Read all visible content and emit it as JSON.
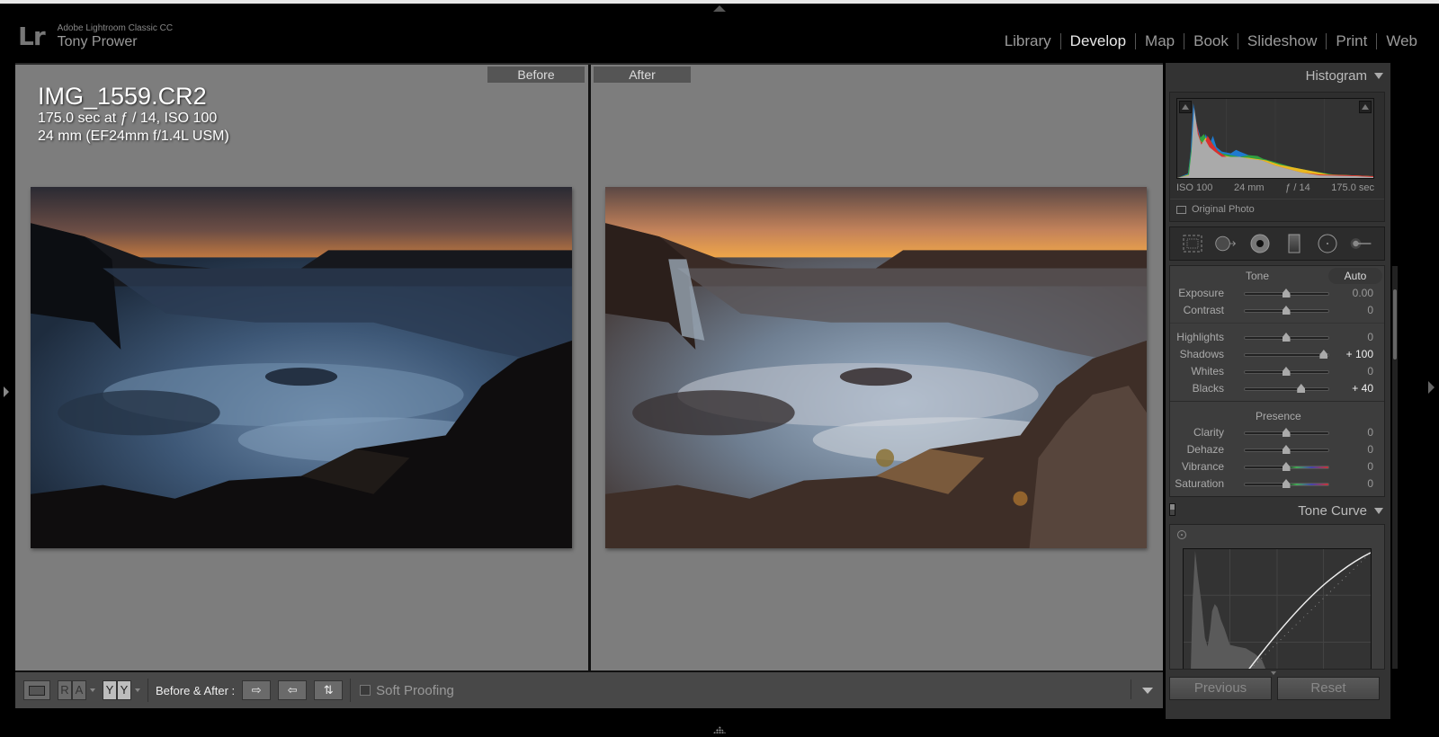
{
  "app": {
    "name": "Adobe Lightroom Classic CC",
    "user": "Tony Prower",
    "logo": "Lr"
  },
  "modules": [
    {
      "label": "Library",
      "active": false
    },
    {
      "label": "Develop",
      "active": true
    },
    {
      "label": "Map",
      "active": false
    },
    {
      "label": "Book",
      "active": false
    },
    {
      "label": "Slideshow",
      "active": false
    },
    {
      "label": "Print",
      "active": false
    },
    {
      "label": "Web",
      "active": false
    }
  ],
  "view": {
    "before_label": "Before",
    "after_label": "After",
    "info": {
      "filename": "IMG_1559.CR2",
      "exposure_line": "175.0 sec at ƒ / 14, ISO 100",
      "lens_line": "24 mm (EF24mm f/1.4L USM)"
    }
  },
  "toolbar": {
    "loupe_icon": "loupe-view-icon",
    "ra_left": "R",
    "ra_right": "A",
    "yy_left": "Y",
    "yy_right": "Y",
    "before_after_label": "Before & After :",
    "copy_before_to_after": "⇨",
    "copy_after_to_before": "⇦",
    "swap": "⇅",
    "soft_proofing_label": "Soft Proofing",
    "soft_proofing_checked": false
  },
  "histogram": {
    "title": "Histogram",
    "iso": "ISO 100",
    "focal": "24 mm",
    "aperture": "ƒ / 14",
    "shutter": "175.0 sec",
    "original_photo_label": "Original Photo"
  },
  "basic": {
    "tone_title": "Tone",
    "auto_label": "Auto",
    "presence_title": "Presence",
    "tone_sliders": [
      {
        "label": "Exposure",
        "value": "0.00",
        "position": 0.5,
        "changed": false
      },
      {
        "label": "Contrast",
        "value": "0",
        "position": 0.5,
        "changed": false
      }
    ],
    "tone_sliders2": [
      {
        "label": "Highlights",
        "value": "0",
        "position": 0.5,
        "changed": false
      },
      {
        "label": "Shadows",
        "value": "+ 100",
        "position": 0.95,
        "changed": true
      },
      {
        "label": "Whites",
        "value": "0",
        "position": 0.5,
        "changed": false
      },
      {
        "label": "Blacks",
        "value": "+ 40",
        "position": 0.68,
        "changed": true
      }
    ],
    "presence_sliders": [
      {
        "label": "Clarity",
        "value": "0",
        "position": 0.5,
        "changed": false,
        "color": false
      },
      {
        "label": "Dehaze",
        "value": "0",
        "position": 0.5,
        "changed": false,
        "color": false
      },
      {
        "label": "Vibrance",
        "value": "0",
        "position": 0.5,
        "changed": false,
        "color": true
      },
      {
        "label": "Saturation",
        "value": "0",
        "position": 0.5,
        "changed": false,
        "color": true
      }
    ]
  },
  "tone_curve": {
    "title": "Tone Curve"
  },
  "footer": {
    "previous_label": "Previous",
    "reset_label": "Reset"
  },
  "colors": {
    "canvas_bg": "#7d7d7d",
    "panel_bg": "#333333",
    "active_module": "#e8e8e8"
  }
}
